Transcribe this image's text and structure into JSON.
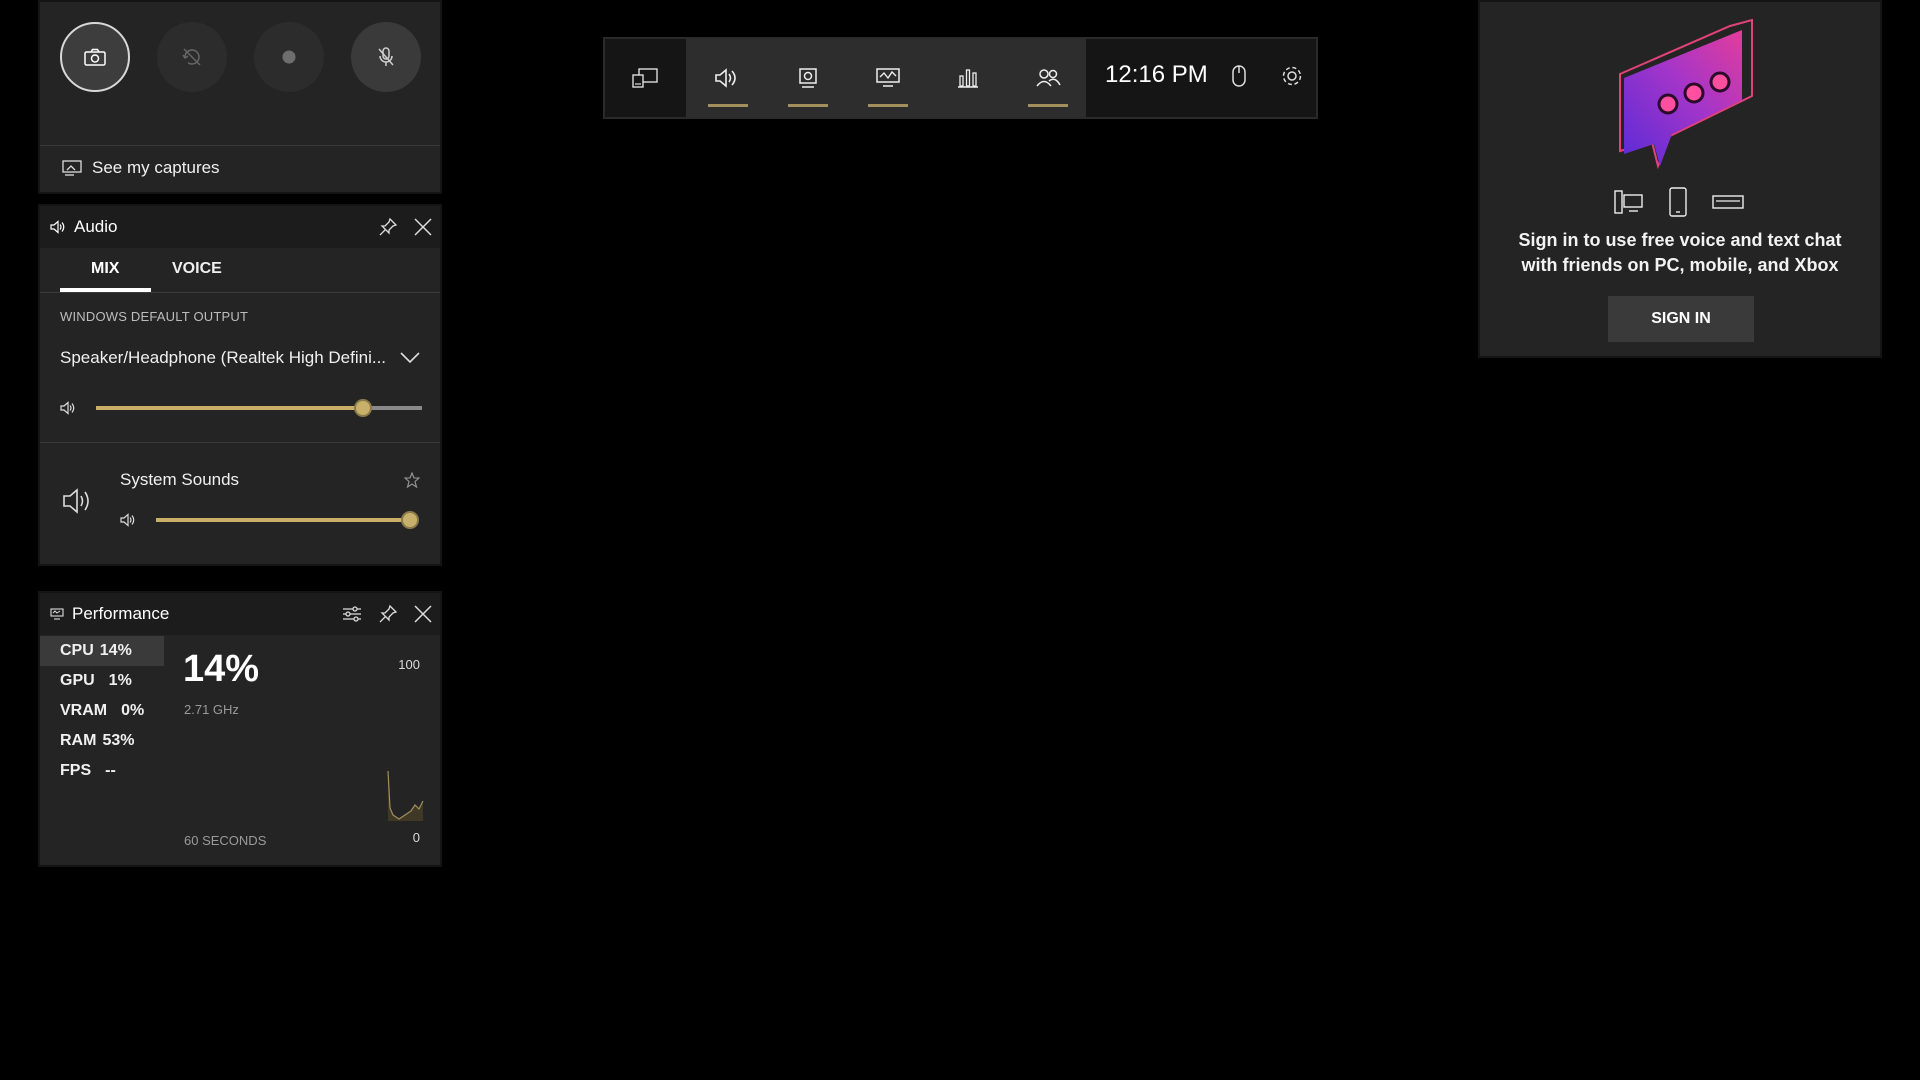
{
  "capture": {
    "see_captures_label": "See my captures"
  },
  "audio": {
    "title": "Audio",
    "tabs": [
      "MIX",
      "VOICE"
    ],
    "output_label": "WINDOWS DEFAULT OUTPUT",
    "device_name": "Speaker/Headphone (Realtek High Defini...",
    "master_volume": 0.82,
    "system_sounds_label": "System Sounds",
    "system_sounds_volume": 1.0,
    "accent_color": "#c8b06a"
  },
  "performance": {
    "title": "Performance",
    "stats": [
      {
        "label": "CPU",
        "value": "14%"
      },
      {
        "label": "GPU",
        "value": "1%"
      },
      {
        "label": "VRAM",
        "value": "0%"
      },
      {
        "label": "RAM",
        "value": "53%"
      },
      {
        "label": "FPS",
        "value": "--"
      }
    ],
    "big_value": "14%",
    "frequency": "2.71 GHz",
    "graph_max": "100",
    "graph_min": "0",
    "graph_window": "60 SECONDS"
  },
  "gamebar": {
    "time": "12:16 PM"
  },
  "social": {
    "message_line1": "Sign in to use free voice and text chat",
    "message_line2": "with friends on PC, mobile, and Xbox",
    "sign_in_label": "SIGN IN"
  }
}
